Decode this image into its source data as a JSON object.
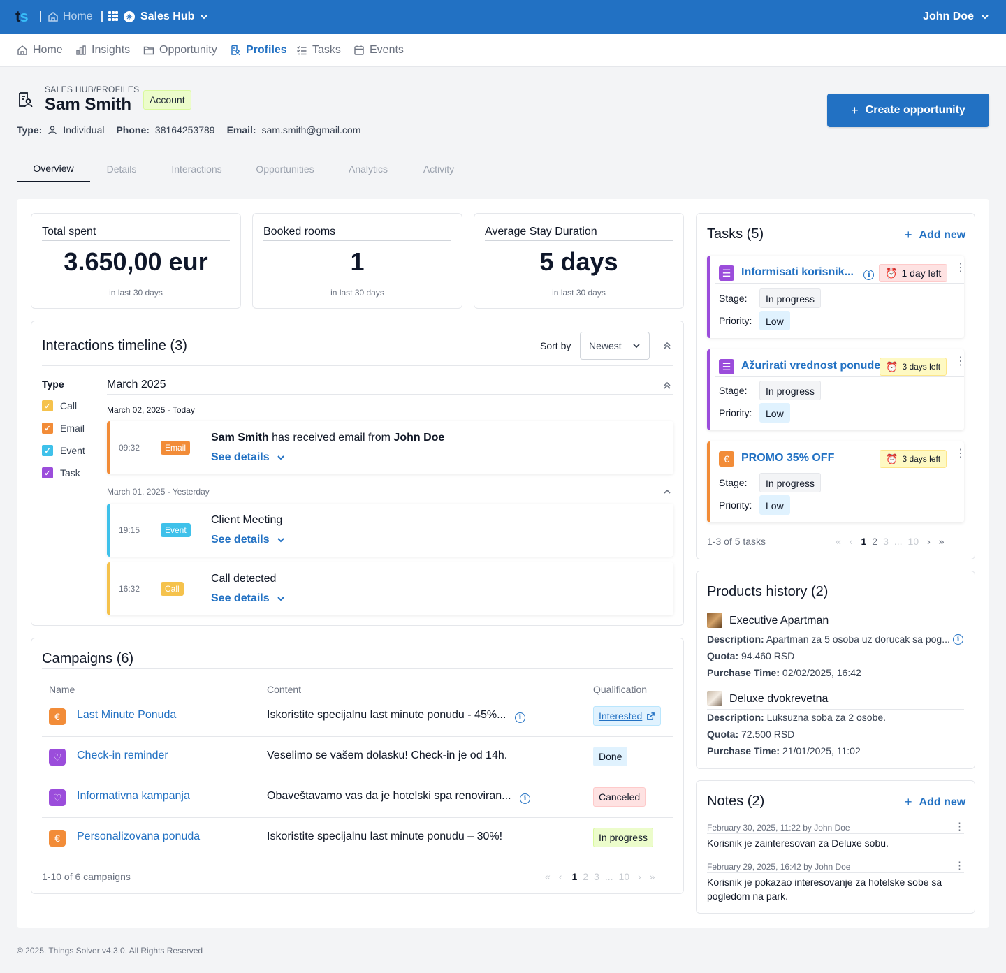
{
  "topbar": {
    "home_label": "Home",
    "hub_label": "Sales Hub",
    "user_name": "John Doe"
  },
  "nav": {
    "items": [
      {
        "label": "Home",
        "icon": "home-icon"
      },
      {
        "label": "Insights",
        "icon": "bar-chart-icon"
      },
      {
        "label": "Opportunity",
        "icon": "folder-icon"
      },
      {
        "label": "Profiles",
        "icon": "profile-icon"
      },
      {
        "label": "Tasks",
        "icon": "checklist-icon"
      },
      {
        "label": "Events",
        "icon": "calendar-icon"
      }
    ],
    "active": "Profiles"
  },
  "header": {
    "breadcrumb": "SALES HUB/PROFILES",
    "name": "Sam Smith",
    "badge": "Account",
    "type_label": "Type:",
    "type_value": "Individual",
    "phone_label": "Phone:",
    "phone_value": "38164253789",
    "email_label": "Email:",
    "email_value": "sam.smith@gmail.com",
    "create_button": "Create opportunity"
  },
  "tabs": [
    "Overview",
    "Details",
    "Interactions",
    "Opportunities",
    "Analytics",
    "Activity"
  ],
  "stats": [
    {
      "label": "Total spent",
      "value": "3.650,00 eur",
      "sub": "in last 30 days"
    },
    {
      "label": "Booked rooms",
      "value": "1",
      "sub": "in last 30 days"
    },
    {
      "label": "Average Stay Duration",
      "value": "5 days",
      "sub": "in last 30 days"
    }
  ],
  "timeline": {
    "title": "Interactions timeline (3)",
    "sort_label": "Sort by",
    "sort_value": "Newest",
    "type_label": "Type",
    "filters": [
      {
        "label": "Call",
        "color": "#f5c24c"
      },
      {
        "label": "Email",
        "color": "#f28c38"
      },
      {
        "label": "Event",
        "color": "#3fc1ea"
      },
      {
        "label": "Task",
        "color": "#9b4ddb"
      }
    ],
    "month": "March 2025",
    "day1": "March 02, 2025 - Today",
    "day2": "March 01, 2025 - Yesterday",
    "items": [
      {
        "time": "09:32",
        "tag": "Email",
        "color": "#f28c38",
        "subject": "Sam Smith",
        "middle": " has received email from ",
        "object": "John Doe",
        "link": "See details"
      },
      {
        "time": "19:15",
        "tag": "Event",
        "color": "#3fc1ea",
        "text": "Client Meeting",
        "link": "See details"
      },
      {
        "time": "16:32",
        "tag": "Call",
        "color": "#f5c24c",
        "text": "Call detected",
        "link": "See details"
      }
    ]
  },
  "campaigns": {
    "title": "Campaigns (6)",
    "col_name": "Name",
    "col_content": "Content",
    "col_qual": "Qualification",
    "rows": [
      {
        "name": "Last Minute Ponuda",
        "icon": "euro-icon",
        "content": "Iskoristite specijalnu last minute ponudu - 45%...",
        "qual": "Interested"
      },
      {
        "name": "Check-in reminder",
        "icon": "heart-icon",
        "content": "Veselimo se vašem dolasku! Check-in je od 14h.",
        "qual": "Done"
      },
      {
        "name": "Informativna kampanja",
        "icon": "heart-icon",
        "content": "Obaveštavamo vas da je hotelski spa renoviran...",
        "qual": "Canceled"
      },
      {
        "name": "Personalizovana ponuda",
        "icon": "euro-icon",
        "content": "Iskoristite specijalnu last minute ponudu – 30%!",
        "qual": "In progress"
      }
    ],
    "summary": "1-10 of 6 campaigns",
    "pages": [
      "1",
      "2",
      "3",
      "...",
      "10"
    ]
  },
  "tasks": {
    "title": "Tasks (5)",
    "add_label": "Add new",
    "stage_label": "Stage:",
    "priority_label": "Priority:",
    "items": [
      {
        "name": "Informisati korisnik...",
        "due": "1 day left",
        "stage": "In progress",
        "priority": "Low",
        "color": "#9b4ddb"
      },
      {
        "name": "Ažurirati vrednost ponude",
        "due": "3 days left",
        "stage": "In progress",
        "priority": "Low",
        "color": "#9b4ddb"
      },
      {
        "name": "PROMO 35% OFF",
        "due": "3 days left",
        "stage": "In progress",
        "priority": "Low",
        "color": "#f28c38"
      }
    ],
    "summary": "1-3 of 5 tasks",
    "pages": [
      "1",
      "2",
      "3",
      "...",
      "10"
    ]
  },
  "products": {
    "title": "Products history (2)",
    "desc_label": "Description:",
    "quota_label": "Quota:",
    "time_label": "Purchase Time:",
    "items": [
      {
        "name": "Executive Apartman",
        "description": "Apartman za 5 osoba uz dorucak sa pog...",
        "quota": "94.460 RSD",
        "time": "02/02/2025, 16:42"
      },
      {
        "name": "Deluxe dvokrevetna",
        "description": "Luksuzna soba za 2 osobe.",
        "quota": "72.500 RSD",
        "time": "21/01/2025, 11:02"
      }
    ]
  },
  "notes": {
    "title": "Notes (2)",
    "add_label": "Add new",
    "items": [
      {
        "meta": "February 30, 2025, 11:22 by John Doe",
        "text": "Korisnik je zainteresovan za Deluxe sobu."
      },
      {
        "meta": "February 29, 2025, 16:42 by John Doe",
        "text": "Korisnik je pokazao interesovanje za hotelske sobe sa pogledom na park."
      }
    ]
  },
  "footer": "© 2025. Things Solver v4.3.0. All Rights Reserved"
}
